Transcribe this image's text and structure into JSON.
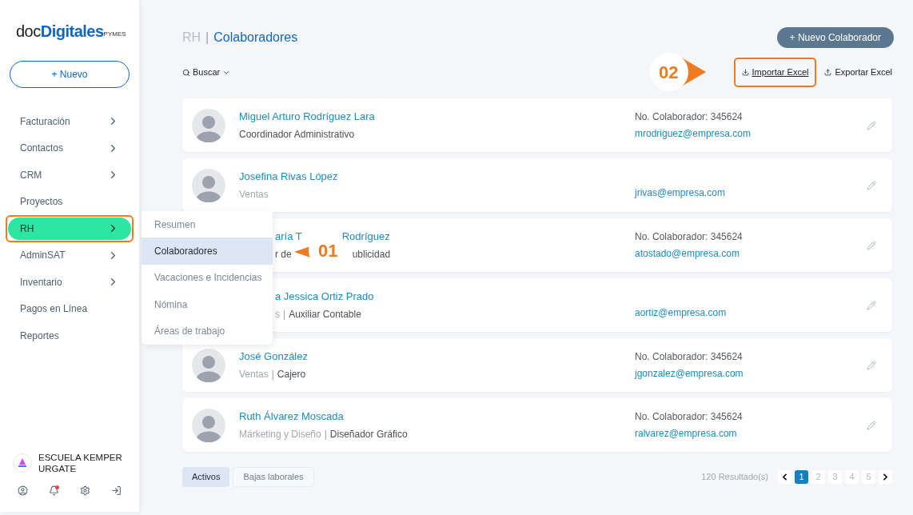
{
  "logo": {
    "prefix": "doc",
    "main": "Digitales",
    "suffix": "PYMES"
  },
  "new_button": "+ Nuevo",
  "nav": [
    {
      "label": "Facturación",
      "has_submenu": true,
      "selected": false,
      "highlighted": false
    },
    {
      "label": "Contactos",
      "has_submenu": true,
      "selected": false,
      "highlighted": false
    },
    {
      "label": "CRM",
      "has_submenu": true,
      "selected": false,
      "highlighted": false
    },
    {
      "label": "Proyectos",
      "has_submenu": false,
      "selected": false,
      "highlighted": false
    },
    {
      "label": "RH",
      "has_submenu": true,
      "selected": true,
      "highlighted": true
    },
    {
      "label": "AdminSAT",
      "has_submenu": true,
      "selected": false,
      "highlighted": false
    },
    {
      "label": "Inventario",
      "has_submenu": true,
      "selected": false,
      "highlighted": false
    },
    {
      "label": "Pagos en Línea",
      "has_submenu": false,
      "selected": false,
      "highlighted": false
    },
    {
      "label": "Reportes",
      "has_submenu": false,
      "selected": false,
      "highlighted": false
    }
  ],
  "submenu": [
    {
      "label": "Resumen",
      "selected": false
    },
    {
      "label": "Colaboradores",
      "selected": true
    },
    {
      "label": "Vacaciones e Incidencias",
      "selected": false
    },
    {
      "label": "Nómina",
      "selected": false
    },
    {
      "label": "Áreas de trabajo",
      "selected": false
    }
  ],
  "company": "ESCUELA KEMPER URGATE",
  "breadcrumb": {
    "section": "RH",
    "separator": "|",
    "page": "Colaboradores"
  },
  "search_label": "Buscar",
  "new_collaborator": "+ Nuevo Colaborador",
  "actions": [
    {
      "label": "Importar Excel",
      "kind": "import",
      "highlighted": true
    },
    {
      "label": "Exportar Excel",
      "kind": "export",
      "highlighted": false
    }
  ],
  "callouts": [
    {
      "label": "01"
    },
    {
      "label": "02"
    }
  ],
  "rows": [
    {
      "avatar": true,
      "name": [
        "Miguel Arturo Rodríguez Lara"
      ],
      "role": [
        "Coordinador Administrativo"
      ],
      "number": "No. Colaborador: 345624",
      "email": "mrodriguez@empresa.com"
    },
    {
      "avatar": true,
      "name": [
        "Josefina Rivas López"
      ],
      "department": "Ventas",
      "email": "jrivas@empresa.com"
    },
    {
      "avatar": false,
      "name": [
        "aría T",
        "Rodríguez"
      ],
      "role": [
        "r de",
        "ublicidad"
      ],
      "number": "No. Colaborador: 345624",
      "email": "atostado@empresa.com"
    },
    {
      "avatar": false,
      "name": [
        "a Jessica Ortiz Prado"
      ],
      "department": "s",
      "separator": "|",
      "role": [
        "Auxiliar Contable"
      ],
      "email": "aortiz@empresa.com"
    },
    {
      "avatar": true,
      "name": [
        "José González"
      ],
      "department": "Ventas",
      "separator": "|",
      "role": [
        "Cajero"
      ],
      "number": "No. Colaborador: 345624",
      "email": "jgonzalez@empresa.com"
    },
    {
      "avatar": true,
      "name": [
        "Ruth Álvarez Moscada"
      ],
      "department": "Márketing y Diseño",
      "separator": "|",
      "role": [
        "Diseñador Gráfico"
      ],
      "number": "No. Colaborador: 345624",
      "email": "ralvarez@empresa.com"
    }
  ],
  "tabs": [
    {
      "label": "Activos",
      "selected": true
    },
    {
      "label": "Bajas laborales",
      "selected": false
    }
  ],
  "results": "120 Resultado(s)",
  "pages": [
    {
      "label": "1",
      "selected": true
    },
    {
      "label": "2",
      "selected": false
    },
    {
      "label": "3",
      "selected": false
    },
    {
      "label": "4",
      "selected": false
    },
    {
      "label": "5",
      "selected": false
    }
  ]
}
